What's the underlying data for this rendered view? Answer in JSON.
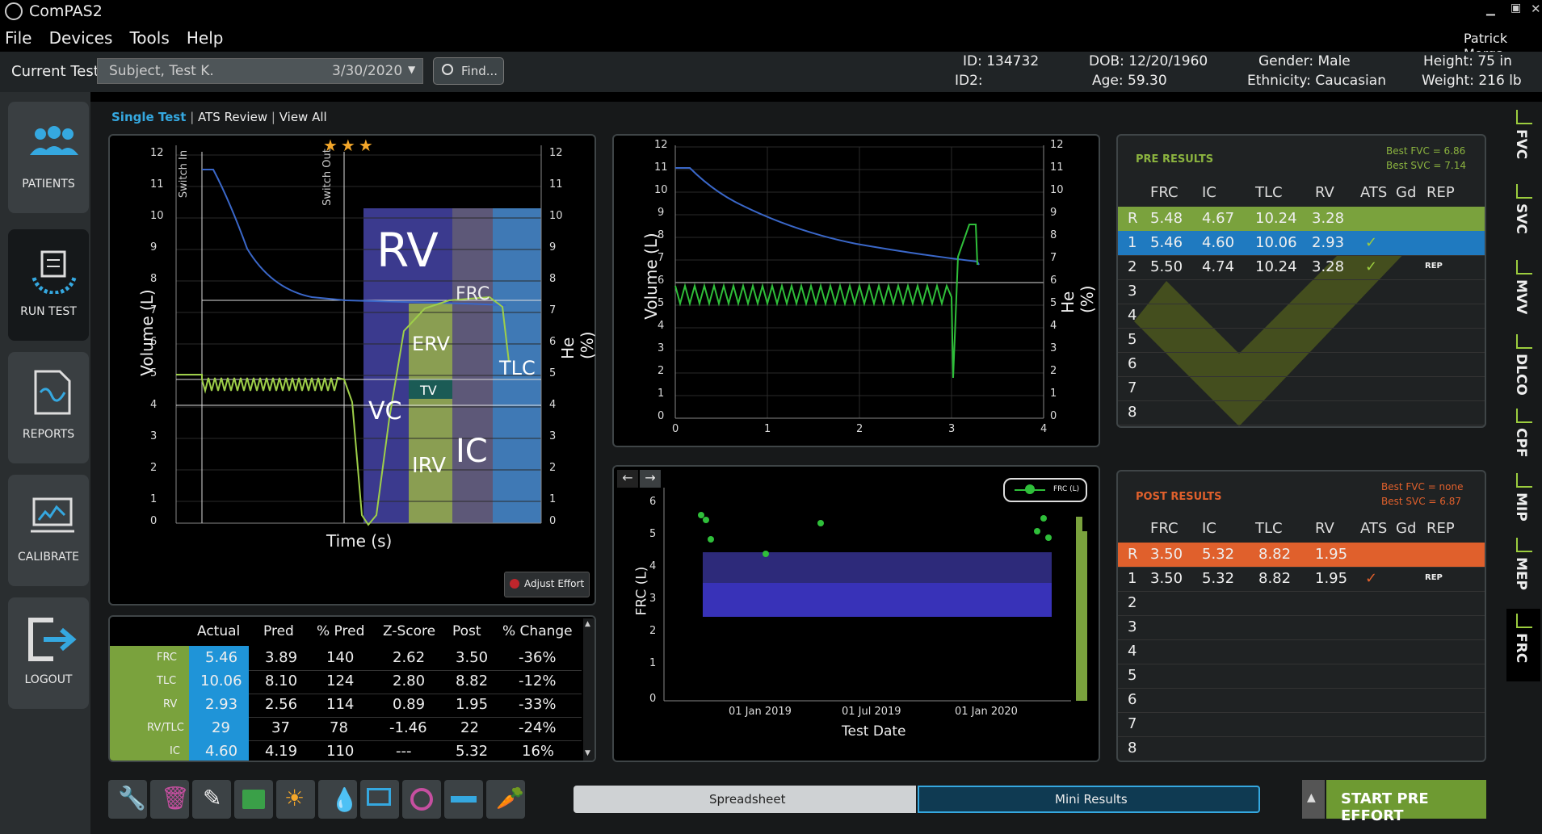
{
  "app": {
    "title": "ComPAS2",
    "user": "Patrick Morga"
  },
  "menu": [
    "File",
    "Devices",
    "Tools",
    "Help"
  ],
  "topbar": {
    "current_test_label": "Current Test:",
    "current_test_name": "Subject, Test K.",
    "current_test_date": "3/30/2020",
    "find_label": "Find...",
    "id": "ID: 134732",
    "id2": "ID2:",
    "dob": "DOB: 12/20/1960",
    "age": "Age: 59.30",
    "gender": "Gender: Male",
    "ethnicity": "Ethnicity: Caucasian",
    "height": "Height: 75 in",
    "weight": "Weight: 216 lb"
  },
  "sidebar": [
    {
      "label": "PATIENTS",
      "icon": "patients-icon"
    },
    {
      "label": "RUN TEST",
      "icon": "run-test-icon"
    },
    {
      "label": "REPORTS",
      "icon": "reports-icon"
    },
    {
      "label": "CALIBRATE",
      "icon": "calibrate-icon"
    },
    {
      "label": "LOGOUT",
      "icon": "logout-icon"
    }
  ],
  "view_tabs": {
    "single": "Single Test",
    "ats": "ATS Review",
    "all": "View All"
  },
  "main_chart": {
    "left_axis_label": "Volume (L)",
    "right_axis_label": "He (%)",
    "x_axis_label": "Time (s)",
    "ticks": [
      "0",
      "1",
      "2",
      "3",
      "4",
      "5",
      "6",
      "7",
      "8",
      "9",
      "10",
      "11",
      "12"
    ],
    "switch_in": "Switch In",
    "switch_out": "Switch Out",
    "region_labels": {
      "rv": "RV",
      "frc": "FRC",
      "erv": "ERV",
      "tlc": "TLC",
      "tv": "TV",
      "vc": "VC",
      "irv": "IRV",
      "ic": "IC"
    },
    "adjust_effort": "Adjust Effort",
    "stars": 3
  },
  "chart_data": [
    {
      "type": "line",
      "ylabel": "Volume (L)",
      "y2label": "He (%)",
      "xlabel": "",
      "xlim": [
        0,
        4
      ],
      "ylim": [
        0,
        12
      ],
      "x_ticks": [
        "0",
        "1",
        "2",
        "3",
        "4"
      ],
      "y_ticks": [
        "0",
        "1",
        "2",
        "3",
        "4",
        "5",
        "6",
        "7",
        "8",
        "9",
        "10",
        "11",
        "12"
      ]
    },
    {
      "type": "scatter",
      "xlabel": "Test Date",
      "ylabel": "FRC (L)",
      "x_ticks": [
        "01 Jan 2019",
        "01 Jul 2019",
        "01 Jan 2020"
      ],
      "y_ticks": [
        "0",
        "1",
        "2",
        "3",
        "4",
        "5",
        "6"
      ],
      "ylim": [
        0,
        6
      ],
      "series": [
        {
          "name": "FRC (L)",
          "values": [
            5.6,
            5.5,
            4.9,
            4.5,
            5.4,
            5.1,
            5.4,
            4.9
          ]
        }
      ]
    }
  ],
  "pre_results": {
    "title": "PRE RESULTS",
    "best_fvc": "Best FVC = 6.86",
    "best_svc": "Best SVC = 7.14",
    "headers": [
      "FRC",
      "IC",
      "TLC",
      "RV",
      "ATS",
      "Gd",
      "REP"
    ],
    "rows": [
      {
        "n": "R",
        "frc": "5.48",
        "ic": "4.67",
        "tlc": "10.24",
        "rv": "3.28",
        "ats": "",
        "rep": ""
      },
      {
        "n": "1",
        "frc": "5.46",
        "ic": "4.60",
        "tlc": "10.06",
        "rv": "2.93",
        "ats": "✓",
        "rep": ""
      },
      {
        "n": "2",
        "frc": "5.50",
        "ic": "4.74",
        "tlc": "10.24",
        "rv": "3.28",
        "ats": "✓",
        "rep": "REP"
      },
      {
        "n": "3",
        "frc": "",
        "ic": "",
        "tlc": "",
        "rv": "",
        "ats": "",
        "rep": ""
      },
      {
        "n": "4",
        "frc": "",
        "ic": "",
        "tlc": "",
        "rv": "",
        "ats": "",
        "rep": ""
      },
      {
        "n": "5",
        "frc": "",
        "ic": "",
        "tlc": "",
        "rv": "",
        "ats": "",
        "rep": ""
      },
      {
        "n": "6",
        "frc": "",
        "ic": "",
        "tlc": "",
        "rv": "",
        "ats": "",
        "rep": ""
      },
      {
        "n": "7",
        "frc": "",
        "ic": "",
        "tlc": "",
        "rv": "",
        "ats": "",
        "rep": ""
      },
      {
        "n": "8",
        "frc": "",
        "ic": "",
        "tlc": "",
        "rv": "",
        "ats": "",
        "rep": ""
      }
    ]
  },
  "post_results": {
    "title": "POST RESULTS",
    "best_fvc": "Best FVC = none",
    "best_svc": "Best SVC = 6.87",
    "headers": [
      "FRC",
      "IC",
      "TLC",
      "RV",
      "ATS",
      "Gd",
      "REP"
    ],
    "rows": [
      {
        "n": "R",
        "frc": "3.50",
        "ic": "5.32",
        "tlc": "8.82",
        "rv": "1.95",
        "ats": "",
        "rep": ""
      },
      {
        "n": "1",
        "frc": "3.50",
        "ic": "5.32",
        "tlc": "8.82",
        "rv": "1.95",
        "ats": "✓",
        "rep": "REP"
      },
      {
        "n": "2",
        "frc": "",
        "ic": "",
        "tlc": "",
        "rv": "",
        "ats": "",
        "rep": ""
      },
      {
        "n": "3",
        "frc": "",
        "ic": "",
        "tlc": "",
        "rv": "",
        "ats": "",
        "rep": ""
      },
      {
        "n": "4",
        "frc": "",
        "ic": "",
        "tlc": "",
        "rv": "",
        "ats": "",
        "rep": ""
      },
      {
        "n": "5",
        "frc": "",
        "ic": "",
        "tlc": "",
        "rv": "",
        "ats": "",
        "rep": ""
      },
      {
        "n": "6",
        "frc": "",
        "ic": "",
        "tlc": "",
        "rv": "",
        "ats": "",
        "rep": ""
      },
      {
        "n": "7",
        "frc": "",
        "ic": "",
        "tlc": "",
        "rv": "",
        "ats": "",
        "rep": ""
      },
      {
        "n": "8",
        "frc": "",
        "ic": "",
        "tlc": "",
        "rv": "",
        "ats": "",
        "rep": ""
      }
    ]
  },
  "results_table": {
    "headers": [
      "Actual",
      "Pred",
      "% Pred",
      "Z-Score",
      "Post",
      "% Change"
    ],
    "rows": [
      {
        "label": "FRC",
        "actual": "5.46",
        "pred": "3.89",
        "pct": "140",
        "z": "2.62",
        "post": "3.50",
        "chg": "-36%"
      },
      {
        "label": "TLC",
        "actual": "10.06",
        "pred": "8.10",
        "pct": "124",
        "z": "2.80",
        "post": "8.82",
        "chg": "-12%"
      },
      {
        "label": "RV",
        "actual": "2.93",
        "pred": "2.56",
        "pct": "114",
        "z": "0.89",
        "post": "1.95",
        "chg": "-33%"
      },
      {
        "label": "RV/TLC",
        "actual": "29",
        "pred": "37",
        "pct": "78",
        "z": "-1.46",
        "post": "22",
        "chg": "-24%"
      },
      {
        "label": "IC",
        "actual": "4.60",
        "pred": "4.19",
        "pct": "110",
        "z": "---",
        "post": "5.32",
        "chg": "16%"
      }
    ]
  },
  "trend_chart": {
    "xlabel": "Test Date",
    "ylabel": "FRC (L)",
    "legend": "FRC (L)"
  },
  "rail": [
    "FVC",
    "SVC",
    "MVV",
    "DLCO",
    "CPF",
    "MIP",
    "MEP",
    "FRC"
  ],
  "bottom": {
    "spreadsheet": "Spreadsheet",
    "mini_results": "Mini Results",
    "start": "START PRE EFFORT"
  },
  "colors": {
    "green": "#8bb33f",
    "blue": "#1f7ac0",
    "orange": "#e0602c",
    "post_title": "#e0602c"
  }
}
